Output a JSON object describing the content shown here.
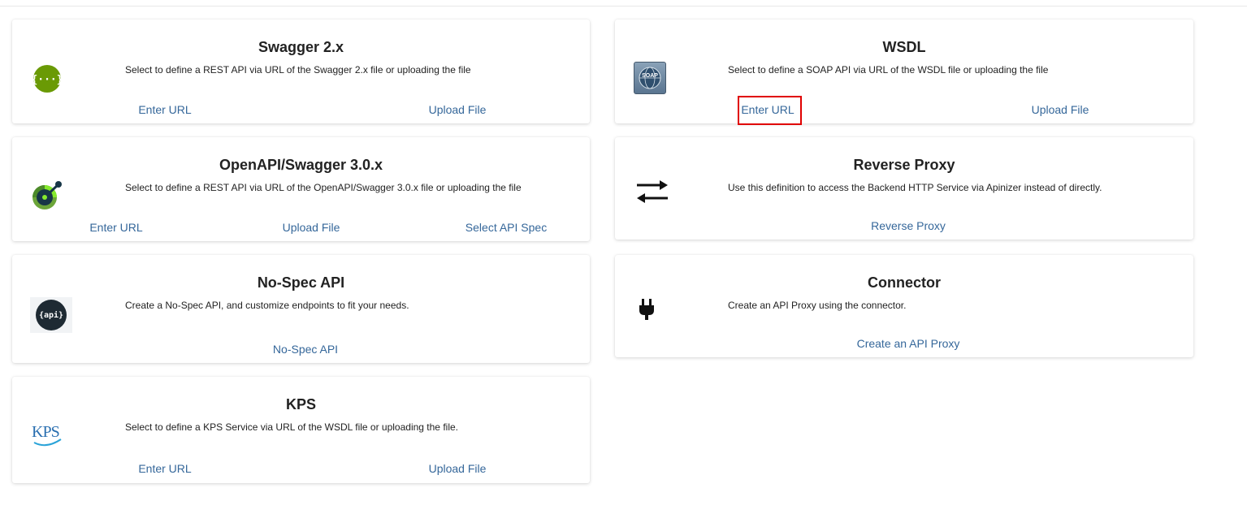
{
  "cards": {
    "swagger2": {
      "title": "Swagger 2.x",
      "description": "Select to define a REST API via URL of the Swagger 2.x file or uploading the file",
      "icon": "swagger-curly-braces-icon",
      "actions": [
        "Enter URL",
        "Upload File"
      ]
    },
    "openapi3": {
      "title": "OpenAPI/Swagger 3.0.x",
      "description": "Select to define a REST API via URL of the OpenAPI/Swagger 3.0.x file or uploading the file",
      "icon": "openapi-icon",
      "actions": [
        "Enter URL",
        "Upload File",
        "Select API Spec"
      ]
    },
    "nospec": {
      "title": "No-Spec API",
      "description": "Create a No-Spec API, and customize endpoints to fit your needs.",
      "icon": "api-badge-icon",
      "icon_text": "{api}",
      "actions": [
        "No-Spec API"
      ]
    },
    "kps": {
      "title": "KPS",
      "description": "Select to define a KPS Service via URL of the WSDL file or uploading the file.",
      "icon": "kps-logo-icon",
      "icon_text": "KPS",
      "actions": [
        "Enter URL",
        "Upload File"
      ]
    },
    "wsdl": {
      "title": "WSDL",
      "description": "Select to define a SOAP API via URL of the WSDL file or uploading the file",
      "icon": "soap-globe-icon",
      "icon_text": "SOAP",
      "actions": [
        "Enter URL",
        "Upload File"
      ],
      "highlighted_action": "Enter URL"
    },
    "reverse_proxy": {
      "title": "Reverse Proxy",
      "description": "Use this definition to access the Backend HTTP Service via Apinizer instead of directly.",
      "icon": "swap-arrows-icon",
      "actions": [
        "Reverse Proxy"
      ]
    },
    "connector": {
      "title": "Connector",
      "description": "Create an API Proxy using the connector.",
      "icon": "plug-icon",
      "actions": [
        "Create an API Proxy"
      ]
    }
  },
  "colors": {
    "link": "#35679a",
    "highlight": "#e00000",
    "swagger_green": "#6a9a05",
    "openapi_green": "#6ba539"
  }
}
